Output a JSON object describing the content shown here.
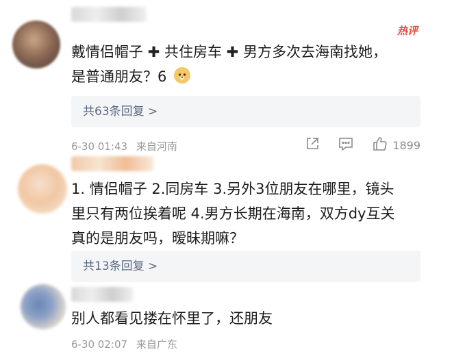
{
  "comments": [
    {
      "hot_badge": "热评",
      "text_lines": [
        "戴情侣帽子",
        "共住房车",
        "男方多次去海南找她，",
        "是普通朋友？6"
      ],
      "replies_label": "共63条回复 >",
      "date": "6-30 01:43",
      "location": "来自河南",
      "like_count": "1899"
    },
    {
      "text_lines": [
        "1. 情侣帽子  2.同房车 3.另外3位朋友在哪里，镜头",
        "里只有两位挨着呢 4.男方长期在海南，双方dy互关",
        "真的是朋友吗，暧昧期嘛？"
      ],
      "replies_label": "共13条回复 >"
    },
    {
      "text_lines": [
        "别人都看见搂在怀里了，还朋友"
      ],
      "date": "6-30 02:07",
      "location": "来自广东"
    }
  ],
  "icons": {
    "share": "share-icon",
    "comment": "comment-icon",
    "like": "thumbs-up-icon",
    "emoji": "doge-emoji-icon"
  },
  "colors": {
    "reply_bg": "#f4f5f7",
    "reply_text": "#5d6a82",
    "meta_text": "#9a9a9a",
    "hot_badge": "#e6493f"
  }
}
